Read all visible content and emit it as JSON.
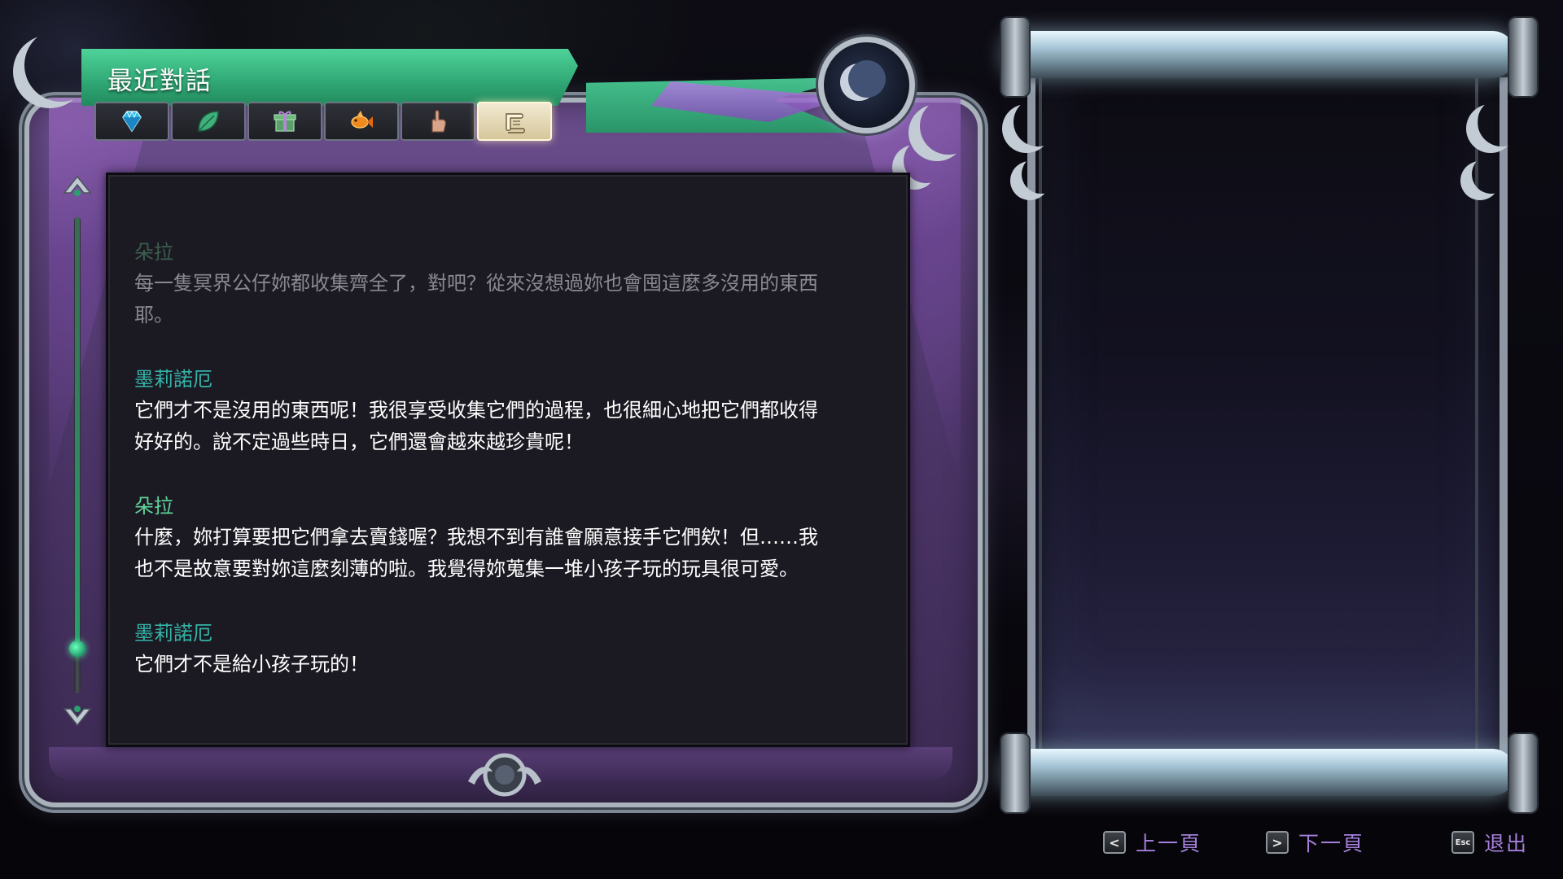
{
  "panel": {
    "title": "最近對話"
  },
  "tabs": [
    {
      "icon": "gem-icon",
      "active": false
    },
    {
      "icon": "leaf-icon",
      "active": false
    },
    {
      "icon": "gift-icon",
      "active": false
    },
    {
      "icon": "fish-icon",
      "active": false
    },
    {
      "icon": "pointing-hand-icon",
      "active": false
    },
    {
      "icon": "scroll-icon",
      "active": true
    }
  ],
  "dialogue": [
    {
      "speaker": "朵拉",
      "lines": [
        "每一隻冥界公仔妳都收集齊全了，對吧？從來沒想過妳也會囤這麼多沒用的東西",
        "耶。"
      ],
      "faded": true
    },
    {
      "speaker": "墨莉諾厄",
      "lines": [
        "它們才不是沒用的東西呢！我很享受收集它們的過程，也很細心地把它們都收得",
        "好好的。說不定過些時日，它們還會越來越珍貴呢！"
      ],
      "faded": false
    },
    {
      "speaker": "朵拉",
      "lines": [
        "什麼，妳打算要把它們拿去賣錢喔？我想不到有誰會願意接手它們欸！但……我",
        "也不是故意要對妳這麼刻薄的啦。我覺得妳蒐集一堆小孩子玩的玩具很可愛。"
      ],
      "faded": false
    },
    {
      "speaker": "墨莉諾厄",
      "lines": [
        "它們才不是給小孩子玩的！"
      ],
      "faded": false
    }
  ],
  "speaker_colors": {
    "朵拉": "#5fd39a",
    "墨莉諾厄": "#35b3a8"
  },
  "scroll": {
    "position": 0.92
  },
  "footer": {
    "prev_key": "<",
    "prev_label": "上一頁",
    "next_key": ">",
    "next_label": "下一頁",
    "exit_key": "Esc",
    "exit_label": "退出"
  },
  "colors": {
    "banner_green": "#2fa774",
    "frame_purple": "#4c3568",
    "hint_purple": "#a57fdc"
  }
}
